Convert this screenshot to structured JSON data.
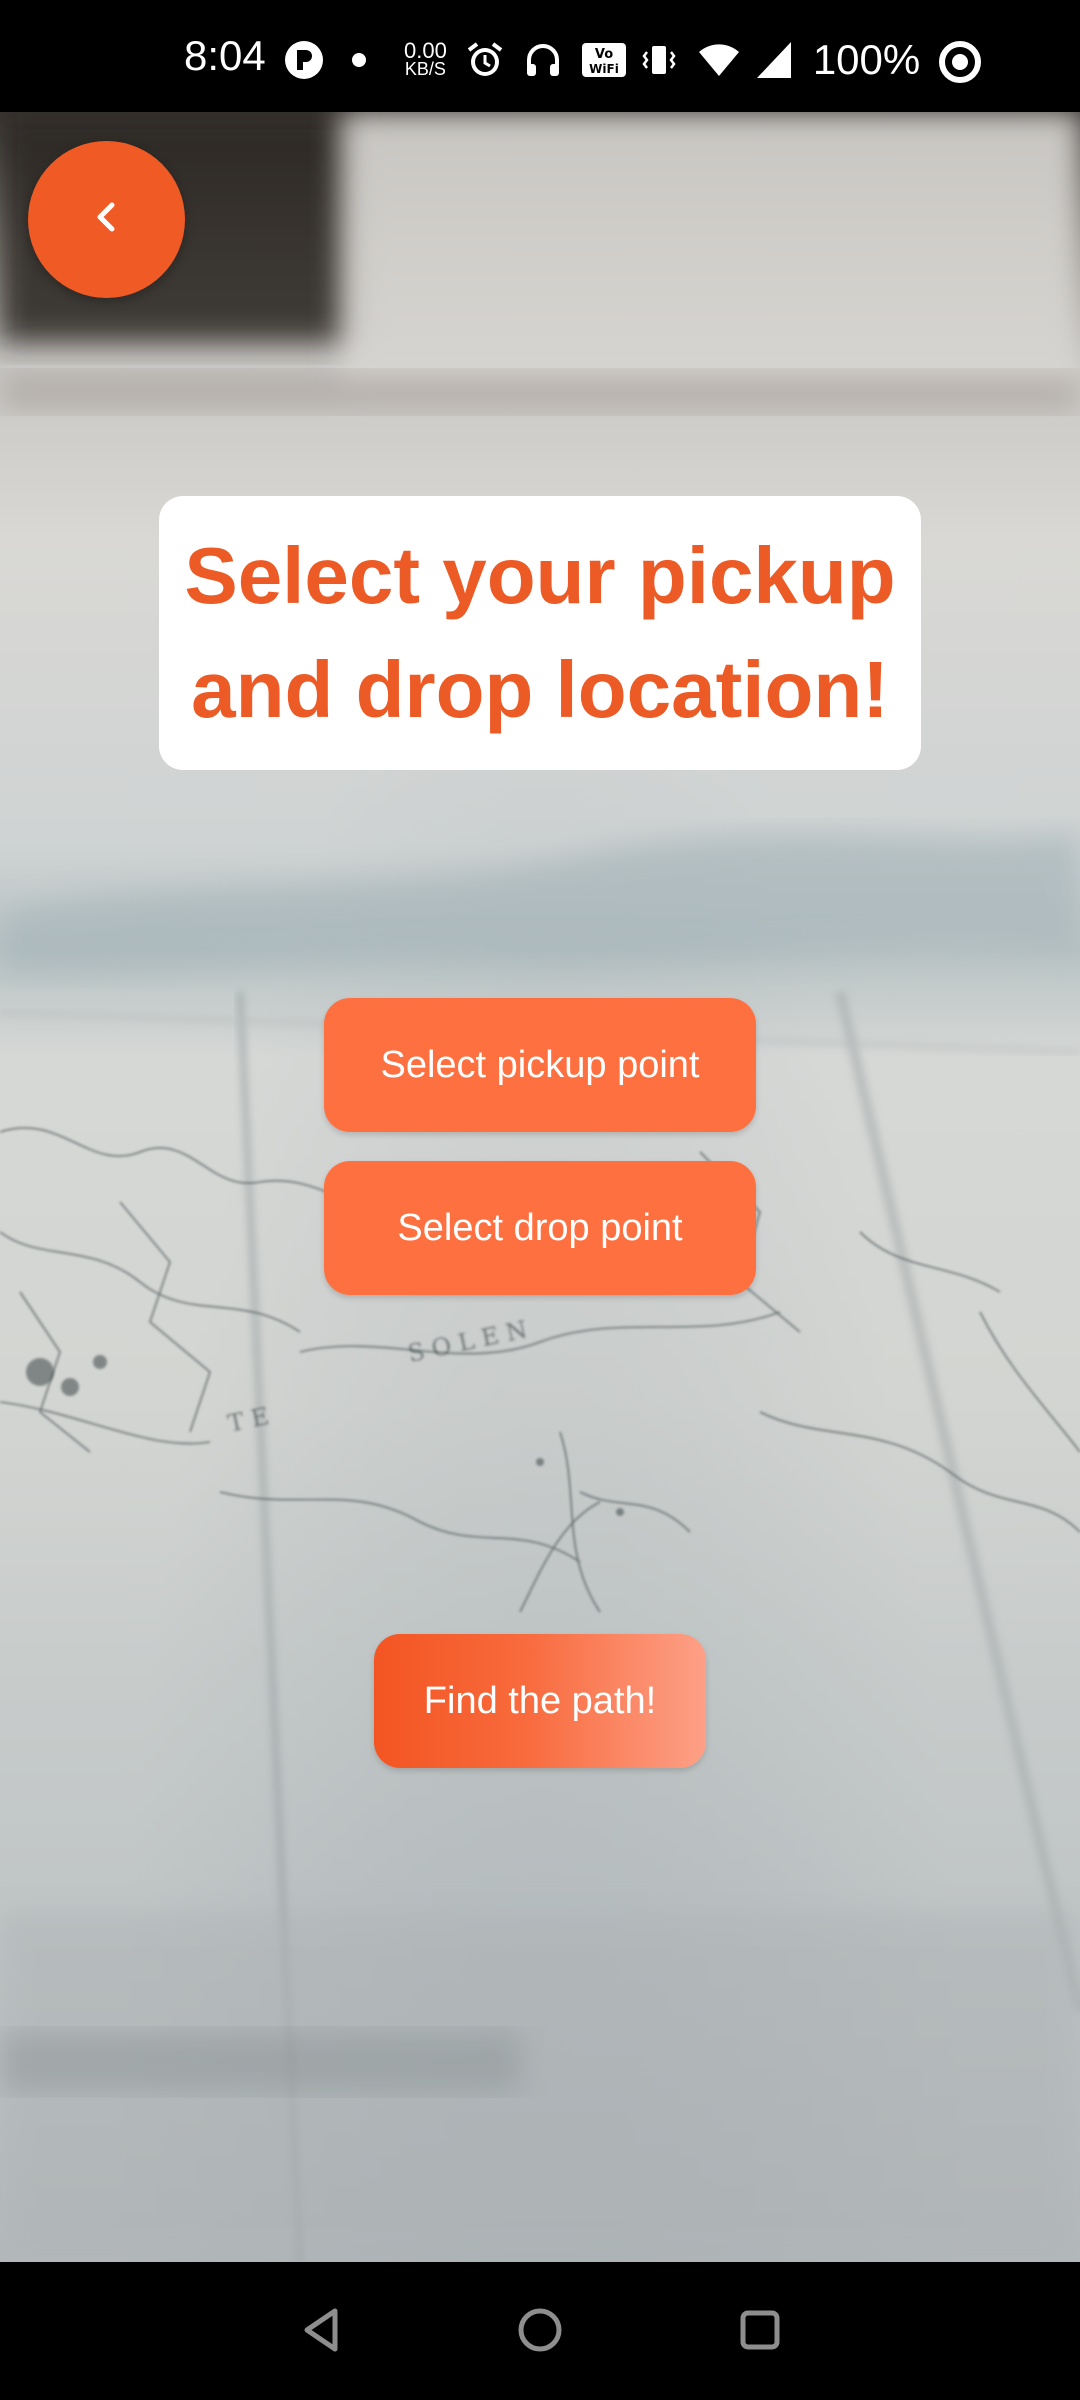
{
  "status_bar": {
    "time": "8:04",
    "net_speed_value": "0.00",
    "net_speed_unit": "KB/S",
    "battery": "100%",
    "icons": [
      "p-app-icon",
      "dot-icon",
      "alarm-icon",
      "headphones-icon",
      "vowifi-icon",
      "vibrate-icon",
      "wifi-icon",
      "signal-icon",
      "battery-ring-icon"
    ]
  },
  "back_button": {
    "icon": "chevron-left-icon",
    "color": "#f05a24"
  },
  "title": {
    "text": "Select your pickup and drop location!",
    "color": "#ec5a26"
  },
  "buttons": {
    "pickup_label": "Select pickup point",
    "drop_label": "Select drop point",
    "find_label": "Find the path!"
  },
  "colors": {
    "accent": "#f05a24",
    "button": "#ff7040"
  },
  "nav_bar": {
    "icons": [
      "back-triangle-icon",
      "home-circle-icon",
      "recents-square-icon"
    ]
  }
}
